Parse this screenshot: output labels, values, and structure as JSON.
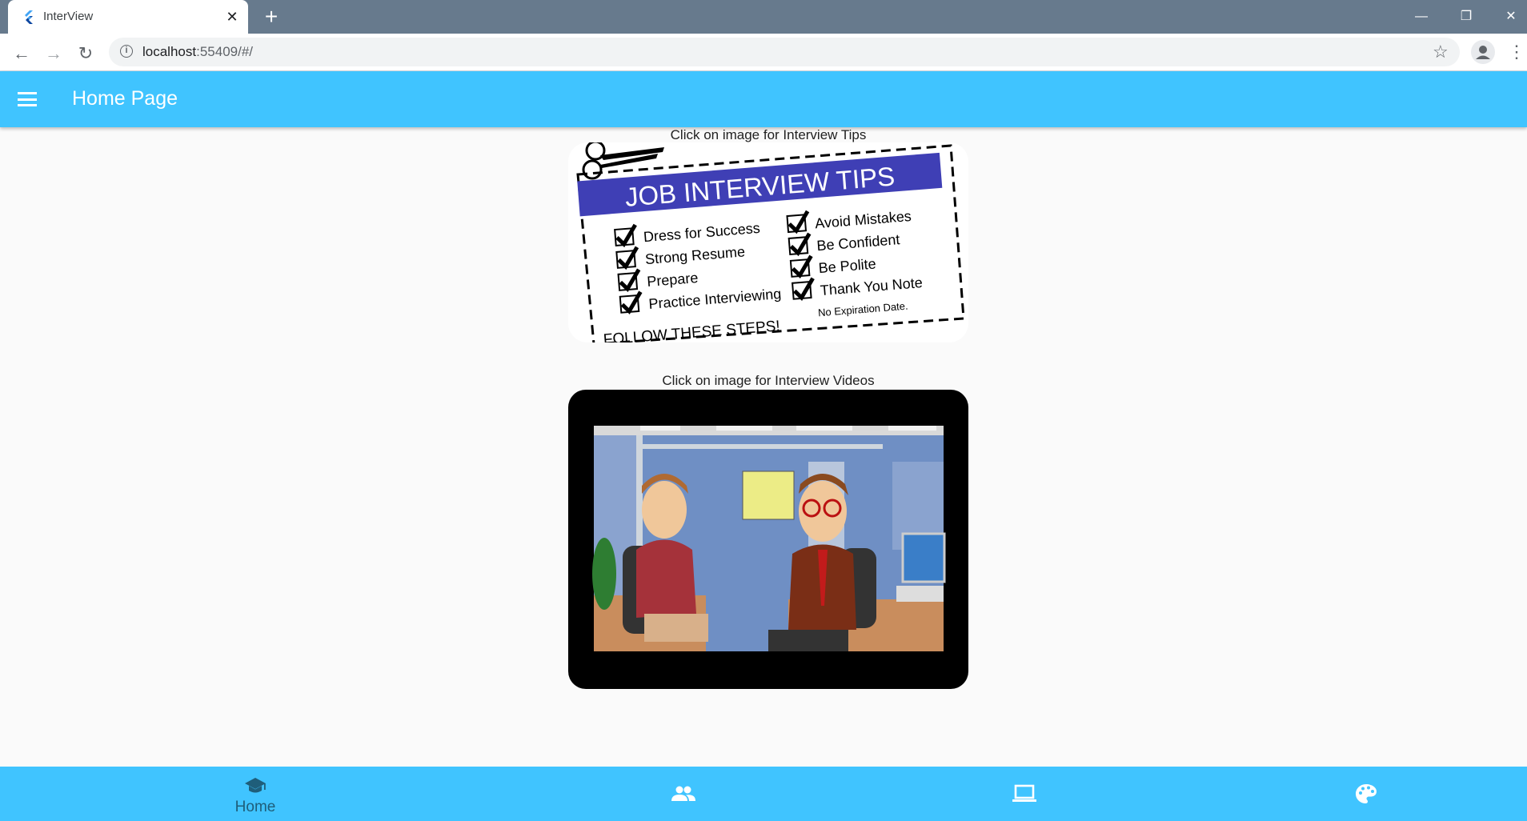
{
  "browser": {
    "tab_title": "InterView",
    "url_host": "localhost",
    "url_rest": ":55409/#/"
  },
  "appbar": {
    "title": "Home Page"
  },
  "tips_section": {
    "caption": "Click on image for Interview Tips",
    "image": {
      "heading": "JOB INTERVIEW TIPS",
      "left_items": [
        "Dress for Success",
        "Strong Resume",
        "Prepare",
        "Practice Interviewing"
      ],
      "right_items": [
        "Avoid Mistakes",
        "Be Confident",
        "Be Polite",
        "Thank You Note"
      ],
      "footer_left": "FOLLOW THESE STEPS!",
      "footer_right": "No Expiration Date.",
      "banner_color": "#3f3fb5"
    }
  },
  "video_section": {
    "caption": "Click on image for Interview Videos"
  },
  "bottom_nav": {
    "items": [
      {
        "label": "Home",
        "icon": "school-icon",
        "selected": true
      },
      {
        "label": "",
        "icon": "people-icon",
        "selected": false
      },
      {
        "label": "",
        "icon": "laptop-icon",
        "selected": false
      },
      {
        "label": "",
        "icon": "palette-icon",
        "selected": false
      }
    ]
  },
  "colors": {
    "app_accent": "#40c4ff",
    "selected_nav": "#1f5e7a"
  }
}
